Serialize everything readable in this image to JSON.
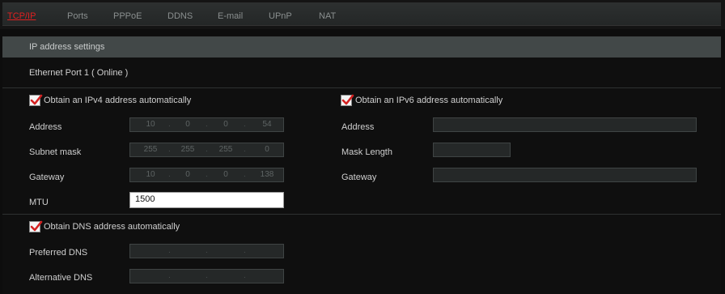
{
  "tabs": [
    {
      "label": "TCP/IP",
      "active": true
    },
    {
      "label": "Ports"
    },
    {
      "label": "PPPoE"
    },
    {
      "label": "DDNS"
    },
    {
      "label": "E-mail"
    },
    {
      "label": "UPnP"
    },
    {
      "label": "NAT"
    }
  ],
  "section_title": "IP address settings",
  "port_status": "Ethernet Port 1 ( Online )",
  "ipv4": {
    "obtain_label": "Obtain an IPv4 address automatically",
    "obtain_checked": true,
    "address_label": "Address",
    "address": [
      "10",
      "0",
      "0",
      "54"
    ],
    "subnet_label": "Subnet mask",
    "subnet": [
      "255",
      "255",
      "255",
      "0"
    ],
    "gateway_label": "Gateway",
    "gateway": [
      "10",
      "0",
      "0",
      "138"
    ],
    "mtu_label": "MTU",
    "mtu": "1500"
  },
  "ipv6": {
    "obtain_label": "Obtain an IPv6 address automatically",
    "obtain_checked": true,
    "address_label": "Address",
    "address": "",
    "mask_label": "Mask Length",
    "mask": "",
    "gateway_label": "Gateway",
    "gateway": ""
  },
  "dns": {
    "obtain_label": "Obtain DNS address automatically",
    "obtain_checked": true,
    "preferred_label": "Preferred DNS",
    "preferred": [
      "",
      "",
      "",
      ""
    ],
    "alternative_label": "Alternative DNS",
    "alternative": [
      "",
      "",
      "",
      ""
    ]
  },
  "colors": {
    "active_tab": "#e02020",
    "check_mark": "#d42020",
    "header_bg": "#424848",
    "page_bg": "#0d0d0d"
  }
}
